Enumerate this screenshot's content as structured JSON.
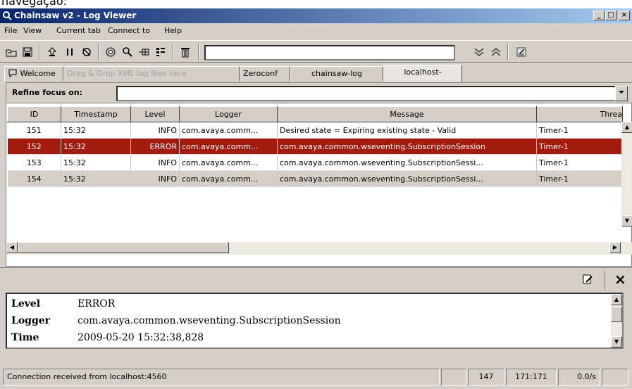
{
  "top_text": "navegação:",
  "window": {
    "title": "Chainsaw v2 - Log Viewer",
    "controls": {
      "minimize": "_",
      "maximize": "□",
      "close": "×"
    }
  },
  "menu": [
    "File",
    "View",
    "Current tab",
    "Connect to",
    "Help"
  ],
  "toolbar": {
    "icons": [
      "folder-back-icon",
      "save-icon",
      "scroll-lock-icon",
      "pause-icon",
      "refresh-icon",
      "detail-pane-icon",
      "find-icon",
      "log-tree-icon",
      "column-toggle-icon",
      "clear-icon"
    ],
    "search_value": "",
    "find_next_label": "↓",
    "find_prev_label": "↑"
  },
  "tabs": [
    {
      "label": "Welcome",
      "state": "normal"
    },
    {
      "label": "Drag & Drop XML log files here",
      "state": "disabled"
    },
    {
      "label": "Zeroconf",
      "state": "normal"
    },
    {
      "label": "chainsaw-log",
      "state": "normal"
    },
    {
      "label": "localhost-",
      "state": "active"
    }
  ],
  "refine": {
    "label": "Refine focus on:",
    "value": ""
  },
  "table": {
    "columns": [
      "ID",
      "Timestamp",
      "Level",
      "Logger",
      "Message",
      "Threa"
    ],
    "rows": [
      {
        "id": "151",
        "timestamp": "15:32",
        "level": "INFO",
        "logger": "com.avaya.comm...",
        "message": "Desired state = Expiring existing state - Valid",
        "thread": "Timer-1",
        "state": "normal"
      },
      {
        "id": "152",
        "timestamp": "15:32",
        "level": "ERROR",
        "logger": "com.avaya.comm...",
        "message": "com.avaya.common.wseventing.SubscriptionSession",
        "thread": "Timer-1",
        "state": "selected"
      },
      {
        "id": "153",
        "timestamp": "15:32",
        "level": "INFO",
        "logger": "com.avaya.comm...",
        "message": "com.avaya.common.wseventing.SubscriptionSessi...",
        "thread": "Timer-1",
        "state": "normal"
      },
      {
        "id": "154",
        "timestamp": "15:32",
        "level": "INFO",
        "logger": "com.avaya.comm...",
        "message": "com.avaya.common.wseventing.SubscriptionSessi...",
        "thread": "Timer-1",
        "state": "gray"
      }
    ]
  },
  "detail": {
    "close_label": "×",
    "fields": [
      {
        "key": "Level",
        "value": "ERROR"
      },
      {
        "key": "Logger",
        "value": "com.avaya.common.wseventing.SubscriptionSession"
      },
      {
        "key": "Time",
        "value": "2009-05-20 15:32:38,828"
      }
    ]
  },
  "status": {
    "message": "Connection received from localhost:4560",
    "blank": "",
    "count": "147",
    "range": "171:171",
    "rate": "0.0/s"
  },
  "colors": {
    "selected_row": "#a21c10",
    "title_start": "#0a246a",
    "title_end": "#a6caf0"
  }
}
